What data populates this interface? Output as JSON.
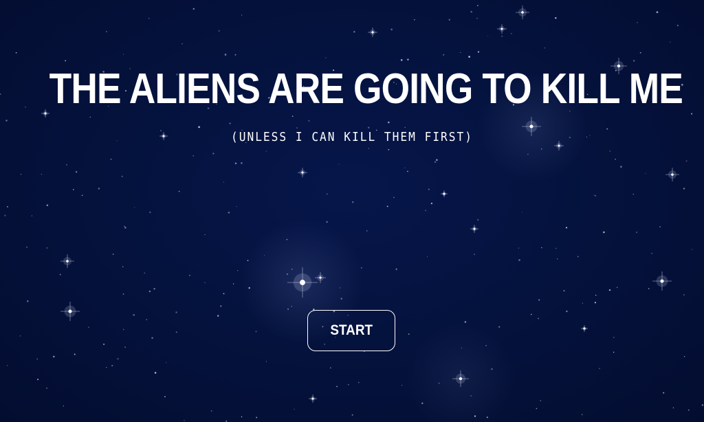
{
  "title": "THE ALIENS ARE GOING TO KILL ME",
  "subtitle": "(UNLESS I CAN KILL THEM FIRST)",
  "start_button": {
    "label": "START"
  },
  "colors": {
    "background": "#04113a",
    "text": "#ffffff",
    "star": "#dfe6ff"
  },
  "icons": {
    "background": "starfield"
  }
}
